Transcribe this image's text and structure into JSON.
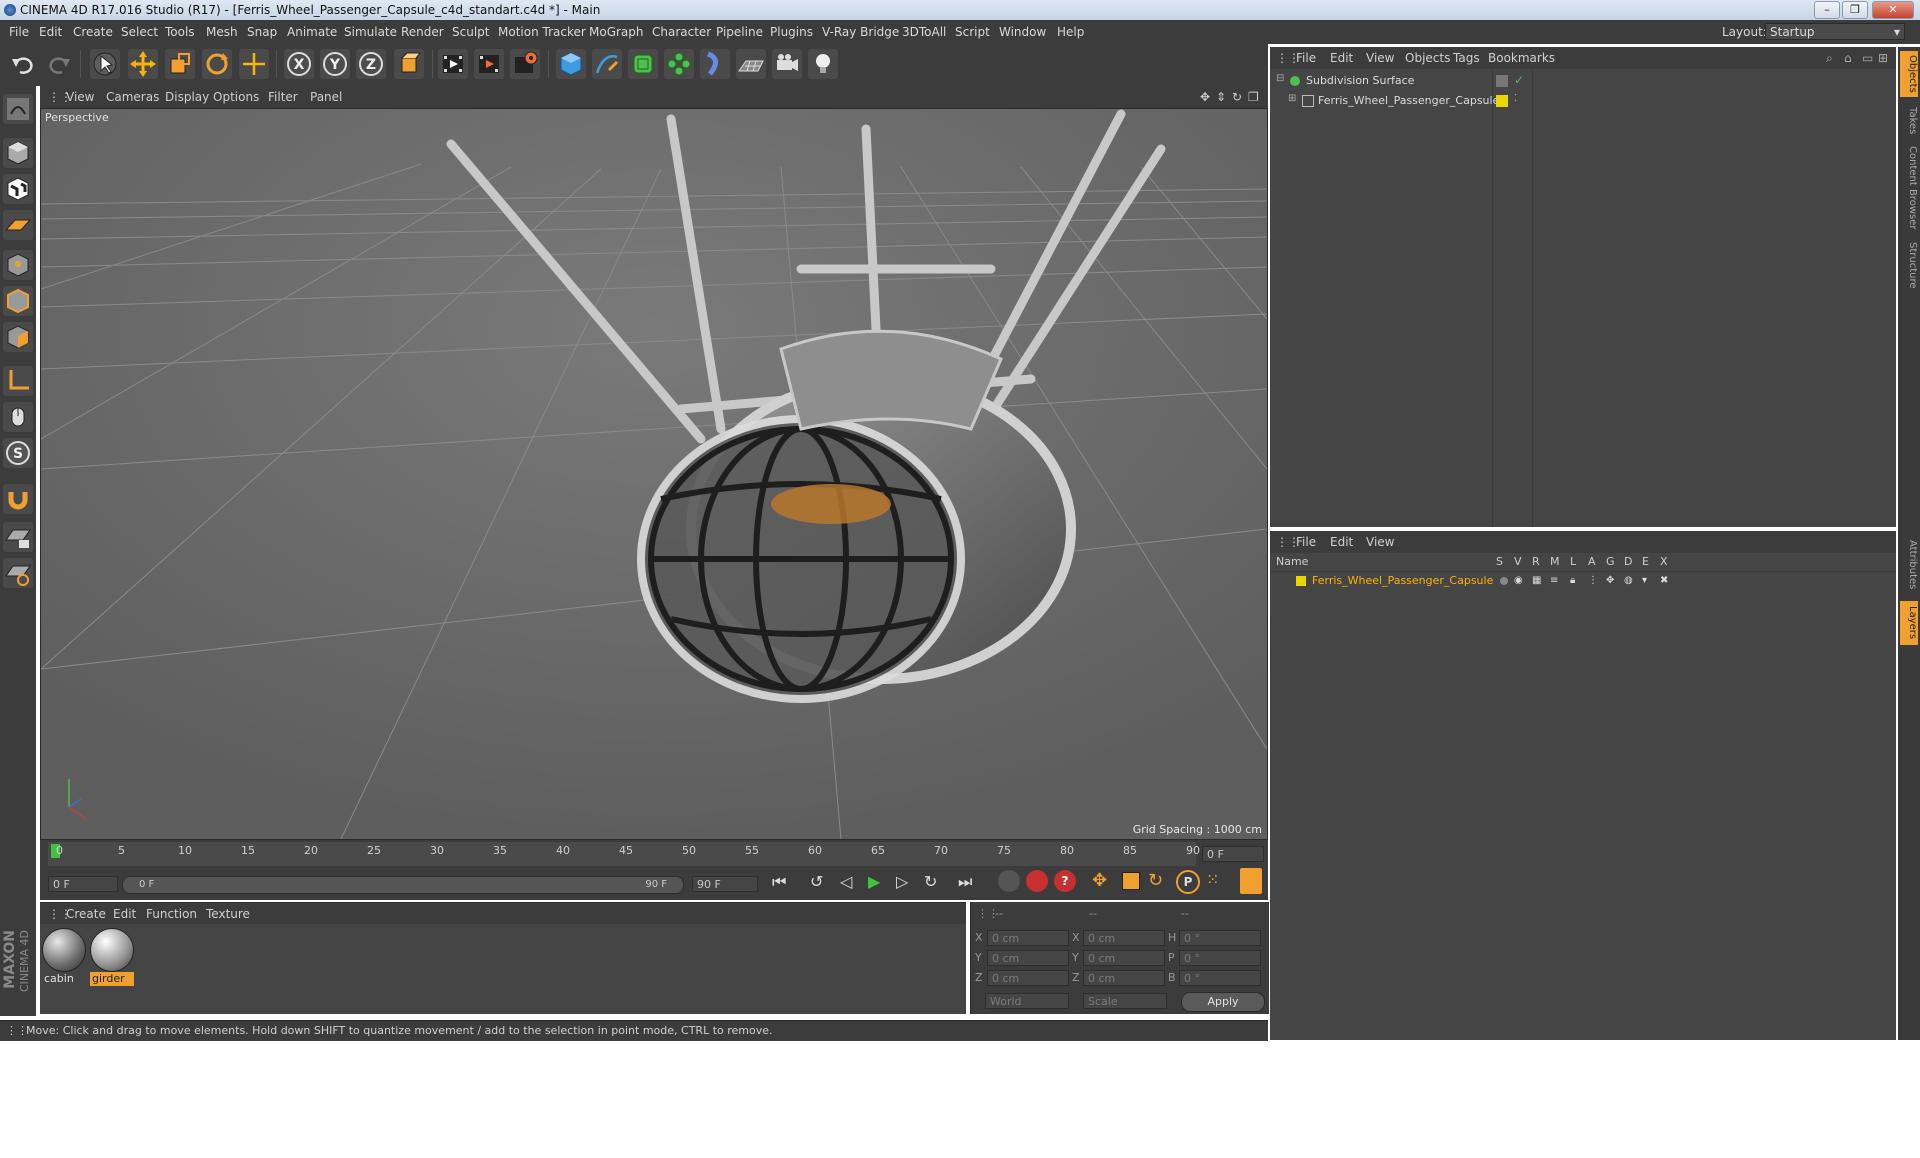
{
  "window": {
    "title": "CINEMA 4D R17.016 Studio (R17) - [Ferris_Wheel_Passenger_Capsule_c4d_standart.c4d *] - Main",
    "minimize_glyph": "–",
    "maximize_glyph": "❐",
    "close_glyph": "✕"
  },
  "menubar": {
    "items": [
      "File",
      "Edit",
      "Create",
      "Select",
      "Tools",
      "Mesh",
      "Snap",
      "Animate",
      "Simulate",
      "Render",
      "Sculpt",
      "Motion Tracker",
      "MoGraph",
      "Character",
      "Pipeline",
      "Plugins",
      "V-Ray Bridge",
      "3DToAll",
      "Script",
      "Window",
      "Help"
    ],
    "layout_label": "Layout:",
    "layout_value": "Startup"
  },
  "toolbar": {
    "icons": [
      "undo-icon",
      "redo-icon",
      "select-arrow-icon",
      "move-icon",
      "scale-icon",
      "rotate-icon",
      "live-select-icon",
      "x-axis-icon",
      "y-axis-icon",
      "z-axis-icon",
      "coordinate-system-icon",
      "render-view-icon",
      "render-picture-viewer-icon",
      "render-settings-icon",
      "cube-icon",
      "pen-spline-icon",
      "subdivision-icon",
      "cloner-icon",
      "deformer-icon",
      "floor-icon",
      "camera-icon",
      "light-icon"
    ],
    "axis_labels": [
      "X",
      "Y",
      "Z"
    ]
  },
  "viewport": {
    "menu": [
      "View",
      "Cameras",
      "Display",
      "Options",
      "Filter",
      "Panel"
    ],
    "label": "Perspective",
    "grid_spacing": "Grid Spacing : 1000 cm"
  },
  "timeline": {
    "ticks": [
      "0",
      "5",
      "10",
      "15",
      "20",
      "25",
      "30",
      "35",
      "40",
      "45",
      "50",
      "55",
      "60",
      "65",
      "70",
      "75",
      "80",
      "85",
      "90"
    ],
    "current_frame": "0 F",
    "start_field": "0 F",
    "range_start": "0 F",
    "range_end": "90 F",
    "end_field": "90 F"
  },
  "materials": {
    "menu": [
      "Create",
      "Edit",
      "Function",
      "Texture"
    ],
    "items": [
      {
        "name": "cabin",
        "selected": false
      },
      {
        "name": "girder",
        "selected": true
      }
    ]
  },
  "coordinates": {
    "headers": [
      "--",
      "--",
      "--"
    ],
    "rows": [
      {
        "label1": "X",
        "v1": "0 cm",
        "label2": "X",
        "v2": "0 cm",
        "label3": "H",
        "v3": "0 °"
      },
      {
        "label1": "Y",
        "v1": "0 cm",
        "label2": "Y",
        "v2": "0 cm",
        "label3": "P",
        "v3": "0 °"
      },
      {
        "label1": "Z",
        "v1": "0 cm",
        "label2": "Z",
        "v2": "0 cm",
        "label3": "B",
        "v3": "0 °"
      }
    ],
    "world": "World",
    "scale": "Scale",
    "apply": "Apply"
  },
  "status": {
    "text": "Move: Click and drag to move elements. Hold down SHIFT to quantize movement / add to the selection in point mode, CTRL to remove."
  },
  "objects": {
    "menu": [
      "File",
      "Edit",
      "View",
      "Objects",
      "Tags",
      "Bookmarks"
    ],
    "items": [
      {
        "name": "Subdivision Surface"
      },
      {
        "name": "Ferris_Wheel_Passenger_Capsule"
      }
    ]
  },
  "layers": {
    "menu": [
      "File",
      "Edit",
      "View"
    ],
    "columns": [
      "Name",
      "S",
      "V",
      "R",
      "M",
      "L",
      "A",
      "G",
      "D",
      "E",
      "X"
    ],
    "items": [
      {
        "name": "Ferris_Wheel_Passenger_Capsule"
      }
    ]
  },
  "side_tabs": [
    "Objects",
    "Takes",
    "Content Browser",
    "Structure",
    "Attributes",
    "Layers"
  ],
  "branding": {
    "line1": "MAXON",
    "line2": "CINEMA 4D"
  },
  "colors": {
    "accent": "#f0a030",
    "selection": "#ffb400",
    "layer_yellow": "#e8d800",
    "play_green": "#3ec43e"
  }
}
